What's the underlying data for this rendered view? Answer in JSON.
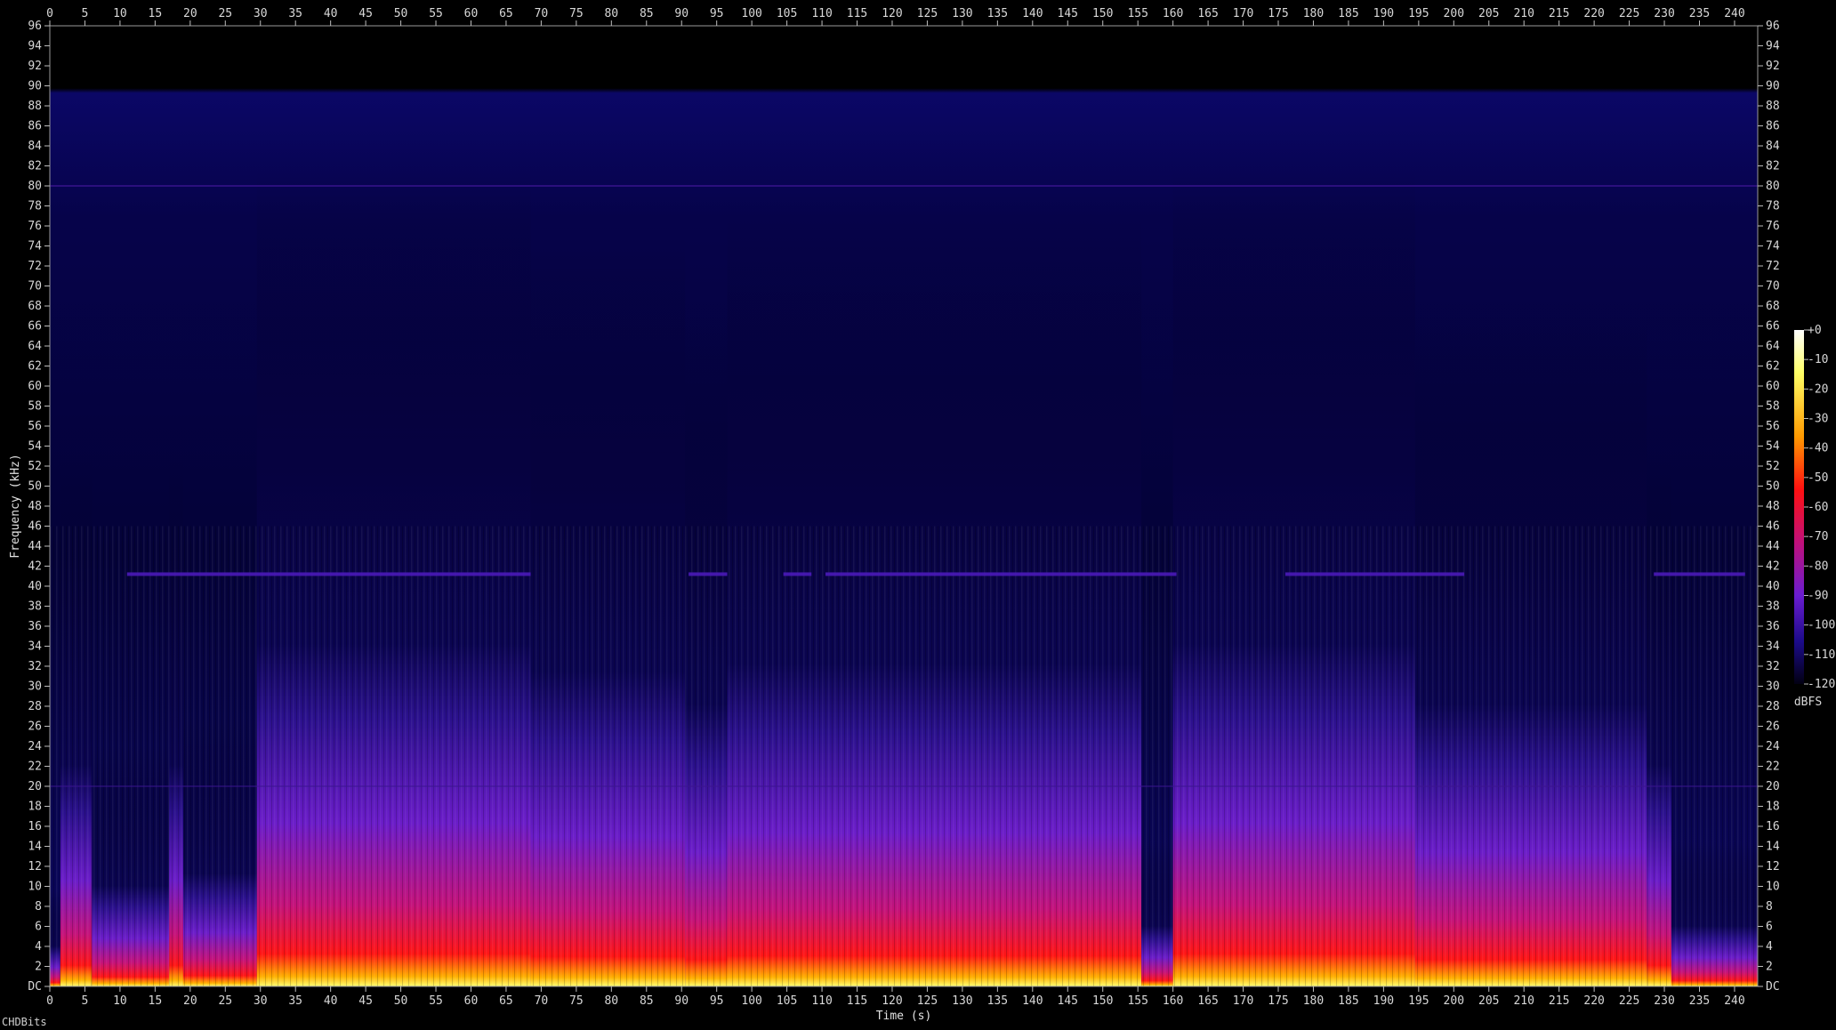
{
  "chart_data": {
    "type": "heatmap",
    "xlabel": "Time (s)",
    "ylabel": "Frequency (kHz)",
    "x_ticks": [
      0,
      5,
      10,
      15,
      20,
      25,
      30,
      35,
      40,
      45,
      50,
      55,
      60,
      65,
      70,
      75,
      80,
      85,
      90,
      95,
      100,
      105,
      110,
      115,
      120,
      125,
      130,
      135,
      140,
      145,
      150,
      155,
      160,
      165,
      170,
      175,
      180,
      185,
      190,
      195,
      200,
      205,
      210,
      215,
      220,
      225,
      230,
      235,
      240
    ],
    "y_ticks": [
      "DC",
      "2",
      "4",
      "6",
      "8",
      "10",
      "12",
      "14",
      "16",
      "18",
      "20",
      "22",
      "24",
      "26",
      "28",
      "30",
      "32",
      "34",
      "36",
      "38",
      "40",
      "42",
      "44",
      "46",
      "48",
      "50",
      "52",
      "54",
      "56",
      "58",
      "60",
      "62",
      "64",
      "66",
      "68",
      "70",
      "72",
      "74",
      "76",
      "78",
      "80",
      "82",
      "84",
      "86",
      "88",
      "90",
      "92",
      "94",
      "96"
    ],
    "xlim": [
      0,
      243.3
    ],
    "ylim": [
      0,
      96
    ],
    "colorbar": {
      "label": "dBFS",
      "ticks": [
        "+0",
        "-10",
        "-20",
        "-30",
        "-40",
        "-50",
        "-60",
        "-70",
        "-80",
        "-90",
        "-100",
        "-110",
        "-120"
      ],
      "range": [
        -120,
        0
      ]
    },
    "segments": [
      {
        "start": 0,
        "end": 1.5,
        "level": 0.1
      },
      {
        "start": 1.5,
        "end": 6,
        "level": 0.55
      },
      {
        "start": 6,
        "end": 17,
        "level": 0.25
      },
      {
        "start": 17,
        "end": 19,
        "level": 0.55
      },
      {
        "start": 19,
        "end": 29.5,
        "level": 0.28
      },
      {
        "start": 29.5,
        "end": 68.5,
        "level": 0.85
      },
      {
        "start": 68.5,
        "end": 90.5,
        "level": 0.78
      },
      {
        "start": 90.5,
        "end": 96.5,
        "level": 0.7
      },
      {
        "start": 96.5,
        "end": 155.5,
        "level": 0.8
      },
      {
        "start": 155.5,
        "end": 160,
        "level": 0.15
      },
      {
        "start": 160,
        "end": 194.5,
        "level": 0.85
      },
      {
        "start": 194.5,
        "end": 227.5,
        "level": 0.7
      },
      {
        "start": 227.5,
        "end": 231,
        "level": 0.55
      },
      {
        "start": 231,
        "end": 243.3,
        "level": 0.15
      }
    ],
    "tone_lines": [
      {
        "khz": 41.2,
        "start": 11,
        "end": 68.5
      },
      {
        "khz": 41.2,
        "start": 91,
        "end": 96.5
      },
      {
        "khz": 41.2,
        "start": 104.5,
        "end": 108.5
      },
      {
        "khz": 41.2,
        "start": 110.5,
        "end": 160.5
      },
      {
        "khz": 41.2,
        "start": 176,
        "end": 201.5
      },
      {
        "khz": 41.2,
        "start": 228.5,
        "end": 241.5
      }
    ],
    "colors": {
      "low": "#020035",
      "mid": "#6a1cd0",
      "high": "#ff1010",
      "peak": "#ffff80"
    }
  },
  "brand": "CHDBits"
}
